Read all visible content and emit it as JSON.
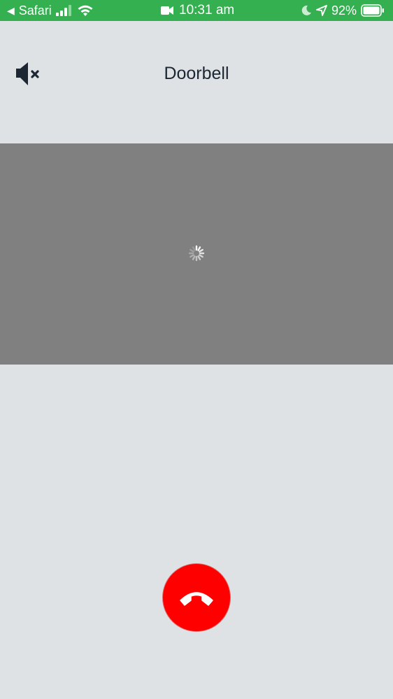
{
  "status_bar": {
    "back_app": "Safari",
    "time": "10:31 am",
    "battery": "92%",
    "color": "#34b050"
  },
  "header": {
    "title": "Doorbell",
    "mute_icon": "speaker-muted-icon"
  },
  "video": {
    "state": "loading",
    "background": "#808080"
  },
  "call": {
    "hangup_icon": "phone-hangup-icon",
    "hangup_color": "#fe0000"
  }
}
